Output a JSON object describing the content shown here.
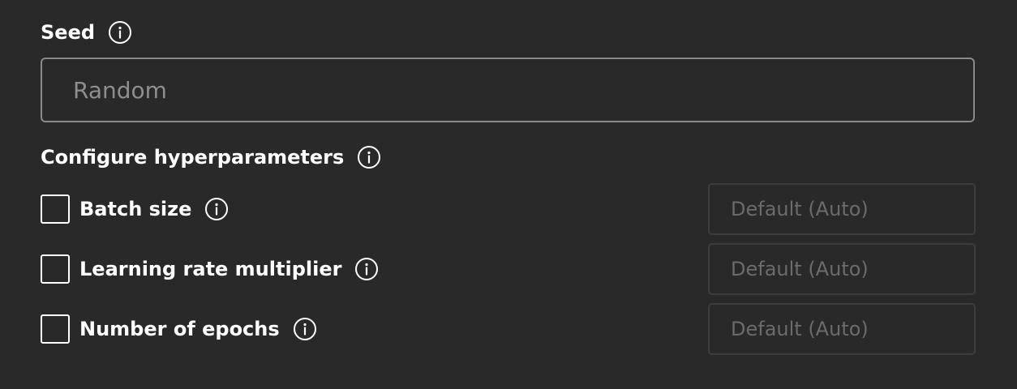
{
  "seed": {
    "label": "Seed",
    "info_icon": "info-icon",
    "placeholder": "Random",
    "value": ""
  },
  "hyperparameters": {
    "label": "Configure hyperparameters",
    "info_icon": "info-icon",
    "items": [
      {
        "label": "Batch size",
        "checked": false,
        "placeholder": "Default (Auto)",
        "value": ""
      },
      {
        "label": "Learning rate multiplier",
        "checked": false,
        "placeholder": "Default (Auto)",
        "value": ""
      },
      {
        "label": "Number of epochs",
        "checked": false,
        "placeholder": "Default (Auto)",
        "value": ""
      }
    ]
  },
  "colors": {
    "background": "#292929",
    "text": "#ffffff",
    "placeholder": "#8e8e8e",
    "input_border": "#8a8a8a",
    "disabled_input_border": "#3d3d3d"
  }
}
